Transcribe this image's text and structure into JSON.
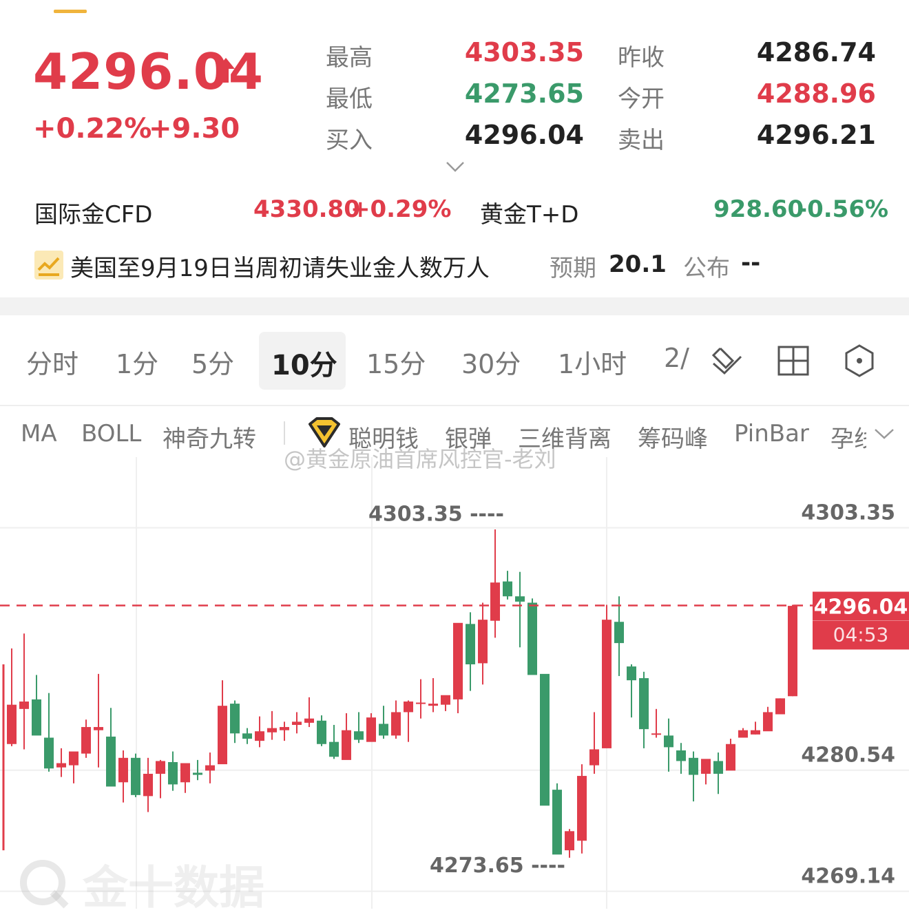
{
  "quote": {
    "price": "4296.04",
    "change_pct": "+0.22%",
    "change_abs": "+9.30",
    "high_label": "最高",
    "high": "4303.35",
    "low_label": "最低",
    "low": "4273.65",
    "bid_label": "买入",
    "bid": "4296.04",
    "prev_close_label": "昨收",
    "prev_close": "4286.74",
    "open_label": "今开",
    "open": "4288.96",
    "ask_label": "卖出",
    "ask": "4296.21"
  },
  "markets": [
    {
      "name": "国际金CFD",
      "price": "4330.80",
      "change": "+0.29%"
    },
    {
      "name": "黄金T+D",
      "price": "928.60",
      "change": "-0.56%"
    }
  ],
  "news": {
    "text": "美国至9月19日当周初请失业金人数万人",
    "expect_label": "预期",
    "expect_value": "20.1",
    "publish_label": "公布",
    "publish_value": "--"
  },
  "timeframes": [
    "分时",
    "1分",
    "5分",
    "10分",
    "15分",
    "30分",
    "1小时",
    "2/"
  ],
  "active_timeframe": "10分",
  "indicators": [
    "MA",
    "BOLL",
    "神奇九转",
    "聪明钱",
    "银弹",
    "三维背离",
    "筹码峰",
    "PinBar",
    "孕线"
  ],
  "watermark": "@黄金原油首席风控官-老刘",
  "brand": "金十数据",
  "colors": {
    "up": "#e03c4a",
    "down": "#3a9a6a",
    "accent": "#f0b43c"
  },
  "chart_data": {
    "type": "candlestick",
    "ylim": [
      4267.5,
      4310.0
    ],
    "y_ticks": [
      "4303.35",
      "4280.54",
      "4269.14"
    ],
    "current_price": "4296.04",
    "countdown": "04:53",
    "high_marker": "4303.35",
    "low_marker": "4273.65",
    "candles": [
      [
        4283.0,
        4292.0,
        4282.8,
        4286.7
      ],
      [
        4286.3,
        4293.4,
        4282.5,
        4287.0
      ],
      [
        4287.2,
        4289.5,
        4283.9,
        4283.8
      ],
      [
        4283.6,
        4287.8,
        4280.4,
        4280.7
      ],
      [
        4280.8,
        4282.6,
        4279.9,
        4281.2
      ],
      [
        4281.0,
        4281.6,
        4279.3,
        4282.3
      ],
      [
        4282.1,
        4285.3,
        4281.7,
        4284.6
      ],
      [
        4284.3,
        4289.6,
        4280.8,
        4284.6
      ],
      [
        4283.7,
        4286.4,
        4279.6,
        4279.0
      ],
      [
        4279.4,
        4282.4,
        4277.5,
        4281.7
      ],
      [
        4281.7,
        4282.1,
        4278.0,
        4278.2
      ],
      [
        4278.1,
        4281.7,
        4276.6,
        4280.2
      ],
      [
        4280.2,
        4281.5,
        4277.9,
        4281.4
      ],
      [
        4281.3,
        4282.3,
        4278.6,
        4279.2
      ],
      [
        4279.4,
        4281.0,
        4278.4,
        4281.2
      ],
      [
        4280.3,
        4281.5,
        4279.6,
        4280.1
      ],
      [
        4280.5,
        4282.2,
        4279.3,
        4281.0
      ],
      [
        4281.1,
        4289.0,
        4281.4,
        4286.6
      ],
      [
        4286.8,
        4287.1,
        4283.1,
        4284.0
      ],
      [
        4284.0,
        4284.5,
        4283.0,
        4283.5
      ],
      [
        4283.3,
        4285.6,
        4282.7,
        4284.2
      ],
      [
        4284.1,
        4286.1,
        4283.4,
        4284.5
      ],
      [
        4284.3,
        4285.1,
        4283.3,
        4284.6
      ],
      [
        4284.8,
        4286.0,
        4284.0,
        4285.1
      ],
      [
        4285.0,
        4287.4,
        4284.6,
        4285.4
      ],
      [
        4285.2,
        4285.7,
        4282.8,
        4283.0
      ],
      [
        4283.2,
        4284.8,
        4281.6,
        4281.8
      ],
      [
        4281.5,
        4285.9,
        4281.9,
        4284.3
      ],
      [
        4284.2,
        4286.0,
        4283.1,
        4283.4
      ],
      [
        4283.2,
        4285.9,
        4283.7,
        4285.5
      ],
      [
        4284.9,
        4286.6,
        4283.5,
        4283.8
      ],
      [
        4283.8,
        4287.1,
        4283.5,
        4286.0
      ],
      [
        4286.0,
        4287.1,
        4283.2,
        4287.0
      ],
      [
        4286.9,
        4289.1,
        4285.4,
        4286.9
      ],
      [
        4286.6,
        4289.2,
        4286.0,
        4286.8
      ],
      [
        4286.7,
        4287.5,
        4286.1,
        4287.6
      ],
      [
        4287.2,
        4294.3,
        4285.9,
        4294.4
      ],
      [
        4294.3,
        4295.4,
        4288.0,
        4290.5
      ],
      [
        4290.6,
        4296.3,
        4288.6,
        4294.7
      ],
      [
        4294.6,
        4303.2,
        4293.0,
        4298.2
      ],
      [
        4298.3,
        4299.3,
        4296.6,
        4296.9
      ],
      [
        4296.9,
        4299.2,
        4292.1,
        4296.4
      ],
      [
        4296.3,
        4296.7,
        4289.9,
        4289.5
      ],
      [
        4289.6,
        4289.2,
        4282.9,
        4277.2
      ],
      [
        4278.7,
        4279.3,
        4275.0,
        4272.6
      ],
      [
        4273.0,
        4275.0,
        4272.3,
        4274.8
      ],
      [
        4273.9,
        4281.1,
        4272.7,
        4280.0
      ],
      [
        4281.0,
        4286.0,
        4280.2,
        4282.5
      ],
      [
        4282.6,
        4296.1,
        4284.2,
        4294.7
      ],
      [
        4294.5,
        4296.9,
        4289.4,
        4292.5
      ],
      [
        4290.3,
        4290.5,
        4285.5,
        4289.0
      ],
      [
        4289.2,
        4289.8,
        4282.6,
        4284.4
      ],
      [
        4283.9,
        4286.3,
        4283.6,
        4284.0
      ],
      [
        4283.8,
        4285.4,
        4280.4,
        4282.7
      ],
      [
        4282.4,
        4283.1,
        4280.2,
        4281.4
      ],
      [
        4281.7,
        4282.3,
        4277.6,
        4280.1
      ],
      [
        4280.2,
        4281.2,
        4279.2,
        4281.6
      ],
      [
        4281.4,
        4282.2,
        4278.3,
        4280.2
      ],
      [
        4280.5,
        4283.5,
        4281.2,
        4283.0
      ],
      [
        4283.6,
        4284.5,
        4283.6,
        4284.3
      ],
      [
        4283.9,
        4285.1,
        4283.9,
        4284.3
      ],
      [
        4284.2,
        4286.5,
        4284.5,
        4286.0
      ],
      [
        4285.8,
        4287.3,
        4286.5,
        4287.3
      ],
      [
        4287.5,
        4296.1,
        4287.5,
        4296.0
      ]
    ]
  }
}
